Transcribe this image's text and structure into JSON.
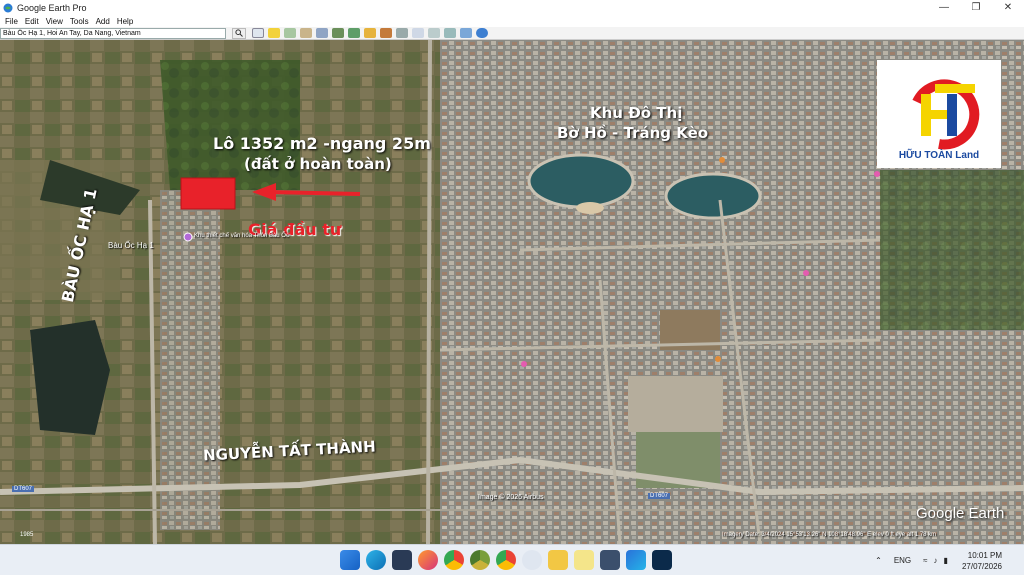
{
  "window": {
    "title": "Google Earth Pro"
  },
  "menu": [
    "File",
    "Edit",
    "View",
    "Tools",
    "Add",
    "Help"
  ],
  "search": {
    "value": "Bàu Ốc Hạ 1, Hoi An Tay, Da Nang, Vietnam"
  },
  "map": {
    "lot_title": "Lô 1352 m2 -ngang 25m",
    "lot_subtitle": "(đất ở hoàn toàn)",
    "price_label": "Giá đầu tư",
    "road_bau_oc": "BÀU ỐC HẠ 1",
    "road_nguyen_tat_thanh": "NGUYỄN TẤT THÀNH",
    "urban_area_line1": "Khu Đô Thị",
    "urban_area_line2": "Bờ Hồ - Tráng Kèo",
    "place_bau_oc": "Bàu Ốc Hạ 1",
    "place_khu_thiet": "Khu thiết chế văn hóa Thôn Bàu Ốc",
    "road_dt607_left": "DT607",
    "road_dt607_right": "DT607",
    "copyright": "Image © 2026 Airbus",
    "watermark": "Google Earth",
    "status_line": "Imagery Date: 3/4/2024    15°53'13.26\" N  108°18'48.96\" E  elev  0 ft   eye alt  1.78 km",
    "year_left": "1985",
    "colors": {
      "annotation_red": "#e8222a",
      "white_text": "#ffffff"
    }
  },
  "logo": {
    "name": "HỮU TOÀN Land",
    "colors": {
      "red": "#e11b22",
      "yellow": "#f5d400",
      "blue": "#1b4aa0"
    }
  },
  "taskbar": {
    "lang": "ENG",
    "time": "10:01 PM",
    "date": "27/07/2026",
    "apps": [
      "windows-start",
      "search",
      "file-explorer",
      "edge",
      "store",
      "firefox",
      "chrome",
      "chrome-alt",
      "chrome-2",
      "people",
      "folder",
      "note",
      "google-earth",
      "photos",
      "photoshop"
    ]
  }
}
